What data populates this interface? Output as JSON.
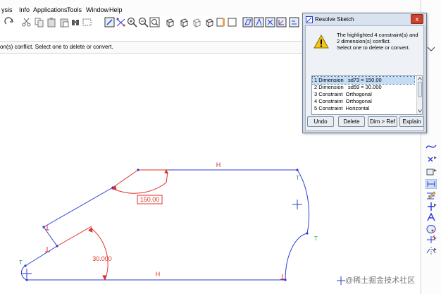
{
  "menu": [
    "ysis",
    "Info",
    "Applications",
    "Tools",
    "Window",
    "Help"
  ],
  "message_bar": "on(s) conflict. Select one to delete or convert.",
  "dialog": {
    "title": "Resolve Sketch",
    "close_glyph": "x",
    "message": [
      "The highlighted 4 constraint(s) and",
      "2 dimension(s) conflict.",
      "Select one to delete or convert."
    ],
    "items": [
      {
        "num": "1",
        "kind": "Dimension",
        "detail": "   sd73 = 150.00",
        "selected": true
      },
      {
        "num": "2",
        "kind": "Dimension",
        "detail": "   sd59 = 30.000",
        "selected": false
      },
      {
        "num": "3",
        "kind": "Constraint",
        "detail": "  Orthogonal",
        "selected": false
      },
      {
        "num": "4",
        "kind": "Constraint",
        "detail": "  Orthogonal",
        "selected": false
      },
      {
        "num": "5",
        "kind": "Constraint",
        "detail": "  Horizontal",
        "selected": false
      }
    ],
    "buttons": {
      "undo": "Undo",
      "delete": "Delete",
      "dim_ref": "Dim > Ref",
      "explain": "Explain"
    }
  },
  "sketch": {
    "dim_150": "150.00",
    "dim_30": "30.000",
    "h_top": "H",
    "h_bottom": "H",
    "t_arc_top": "T",
    "t_arc_right": "T",
    "t_left": "T"
  },
  "colors": {
    "geometry": "#2b3bd6",
    "dimension": "#e0322b",
    "constraint_green": "#1a9b5a"
  },
  "watermark": "@稀土掘金技术社区"
}
